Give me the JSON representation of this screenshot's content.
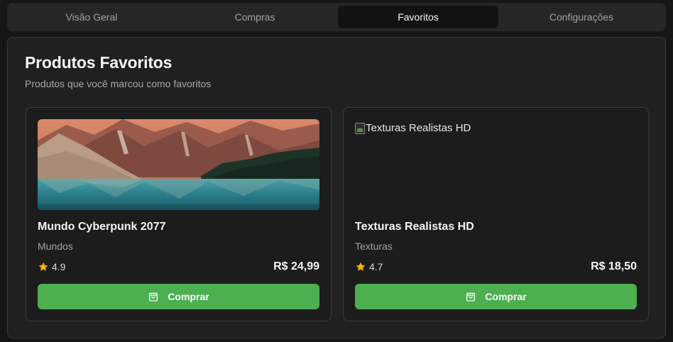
{
  "tabs": [
    {
      "label": "Visão Geral"
    },
    {
      "label": "Compras"
    },
    {
      "label": "Favoritos"
    },
    {
      "label": "Configurações"
    }
  ],
  "active_tab": "Favoritos",
  "panel": {
    "title": "Produtos Favoritos",
    "subtitle": "Produtos que você marcou como favoritos"
  },
  "products": [
    {
      "title": "Mundo Cyberpunk 2077",
      "category": "Mundos",
      "rating": "4.9",
      "price": "R$ 24,99",
      "buy_label": "Comprar",
      "image": "landscape-mountain-lake"
    },
    {
      "title": "Texturas Realistas HD",
      "image_alt": "Texturas Realistas HD",
      "category": "Texturas",
      "rating": "4.7",
      "price": "R$ 18,50",
      "buy_label": "Comprar",
      "image": "broken"
    }
  ],
  "colors": {
    "accent_green": "#4caf50",
    "star": "#f5b400",
    "background": "#161616",
    "panel": "#202020"
  },
  "icons": {
    "rating": "star-icon",
    "buy": "shopping-bag-icon"
  }
}
